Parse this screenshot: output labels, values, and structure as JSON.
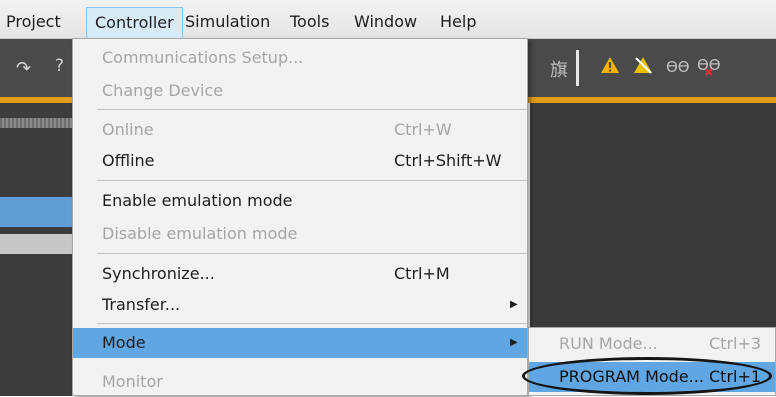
{
  "menubar": {
    "items": [
      "Project",
      "Controller",
      "Simulation",
      "Tools",
      "Window",
      "Help"
    ]
  },
  "controller_menu": {
    "communications_setup": "Communications Setup...",
    "change_device": "Change Device",
    "online": "Online",
    "online_shortcut": "Ctrl+W",
    "offline": "Offline",
    "offline_shortcut": "Ctrl+Shift+W",
    "enable_emulation": "Enable emulation mode",
    "disable_emulation": "Disable emulation mode",
    "synchronize": "Synchronize...",
    "synchronize_shortcut": "Ctrl+M",
    "transfer": "Transfer...",
    "mode": "Mode",
    "monitor": "Monitor"
  },
  "mode_submenu": {
    "run_mode": "RUN Mode...",
    "run_shortcut": "Ctrl+3",
    "program_mode": "PROGRAM Mode...",
    "program_shortcut": "Ctrl+1"
  },
  "toolbar": {
    "icons": [
      "redo-icon",
      "help-icon",
      "flag-icon",
      "warning-icon",
      "warning-disabled-icon",
      "glasses-icon",
      "glasses-error-icon"
    ]
  },
  "colors": {
    "highlight": "#60a6e2",
    "toolbar_bg": "#4a4a4a",
    "accent_line": "#e39b1c"
  }
}
